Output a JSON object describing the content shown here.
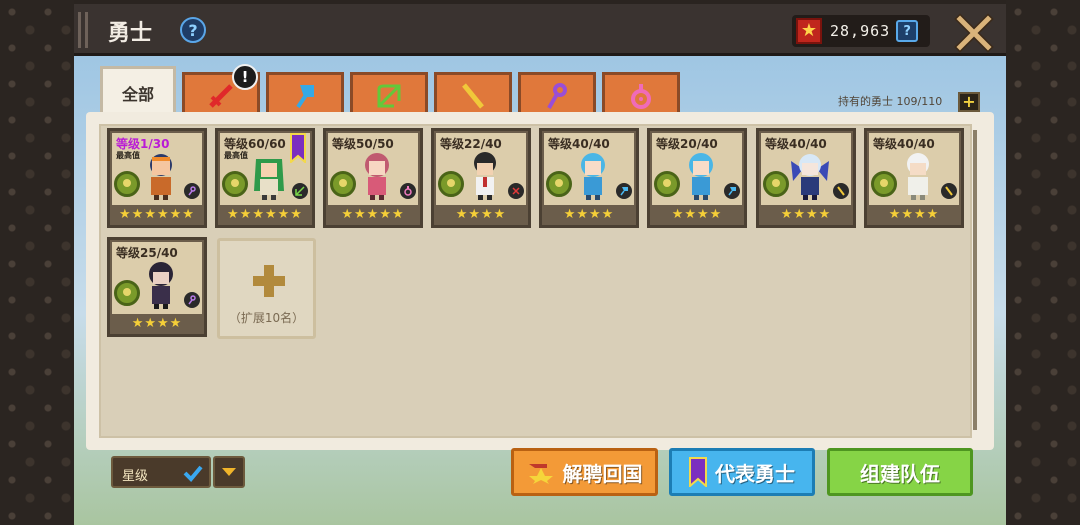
{
  "header": {
    "title": "勇士",
    "currency_value": "28,963"
  },
  "tabs": {
    "all_label": "全部",
    "classes": [
      {
        "name": "sword-icon",
        "color": "#e0292a"
      },
      {
        "name": "axe-icon",
        "color": "#35a9e6"
      },
      {
        "name": "bow-icon",
        "color": "#63c83a"
      },
      {
        "name": "gun-icon",
        "color": "#f0c83a"
      },
      {
        "name": "staff-icon",
        "color": "#9a4ed6"
      },
      {
        "name": "amulet-icon",
        "color": "#f06bb8"
      }
    ],
    "badge": "!"
  },
  "owned": {
    "label": "持有的勇士 109/110"
  },
  "heroes": [
    {
      "level": "等级1/30",
      "max": "最高值",
      "stars": "★★★★★★",
      "class": "staff-icon"
    },
    {
      "level": "等级60/60",
      "max": "最高值",
      "stars": "★★★★★★",
      "class": "bow-icon"
    },
    {
      "level": "等级50/50",
      "stars": "★★★★★",
      "class": "amulet-icon"
    },
    {
      "level": "等级22/40",
      "stars": "★★★★",
      "class": "sword-icon"
    },
    {
      "level": "等级40/40",
      "stars": "★★★★",
      "class": "axe-icon"
    },
    {
      "level": "等级20/40",
      "stars": "★★★★",
      "class": "axe-icon"
    },
    {
      "level": "等级40/40",
      "stars": "★★★★",
      "class": "gun-icon"
    },
    {
      "level": "等级40/40",
      "stars": "★★★★",
      "class": "gun-icon"
    },
    {
      "level": "等级25/40",
      "stars": "★★★★",
      "class": "staff-icon"
    }
  ],
  "expand": {
    "label": "（扩展10名）"
  },
  "sort": {
    "label": "星级"
  },
  "buttons": {
    "dismiss": "解聘回国",
    "representative": "代表勇士",
    "form_team": "组建队伍"
  }
}
